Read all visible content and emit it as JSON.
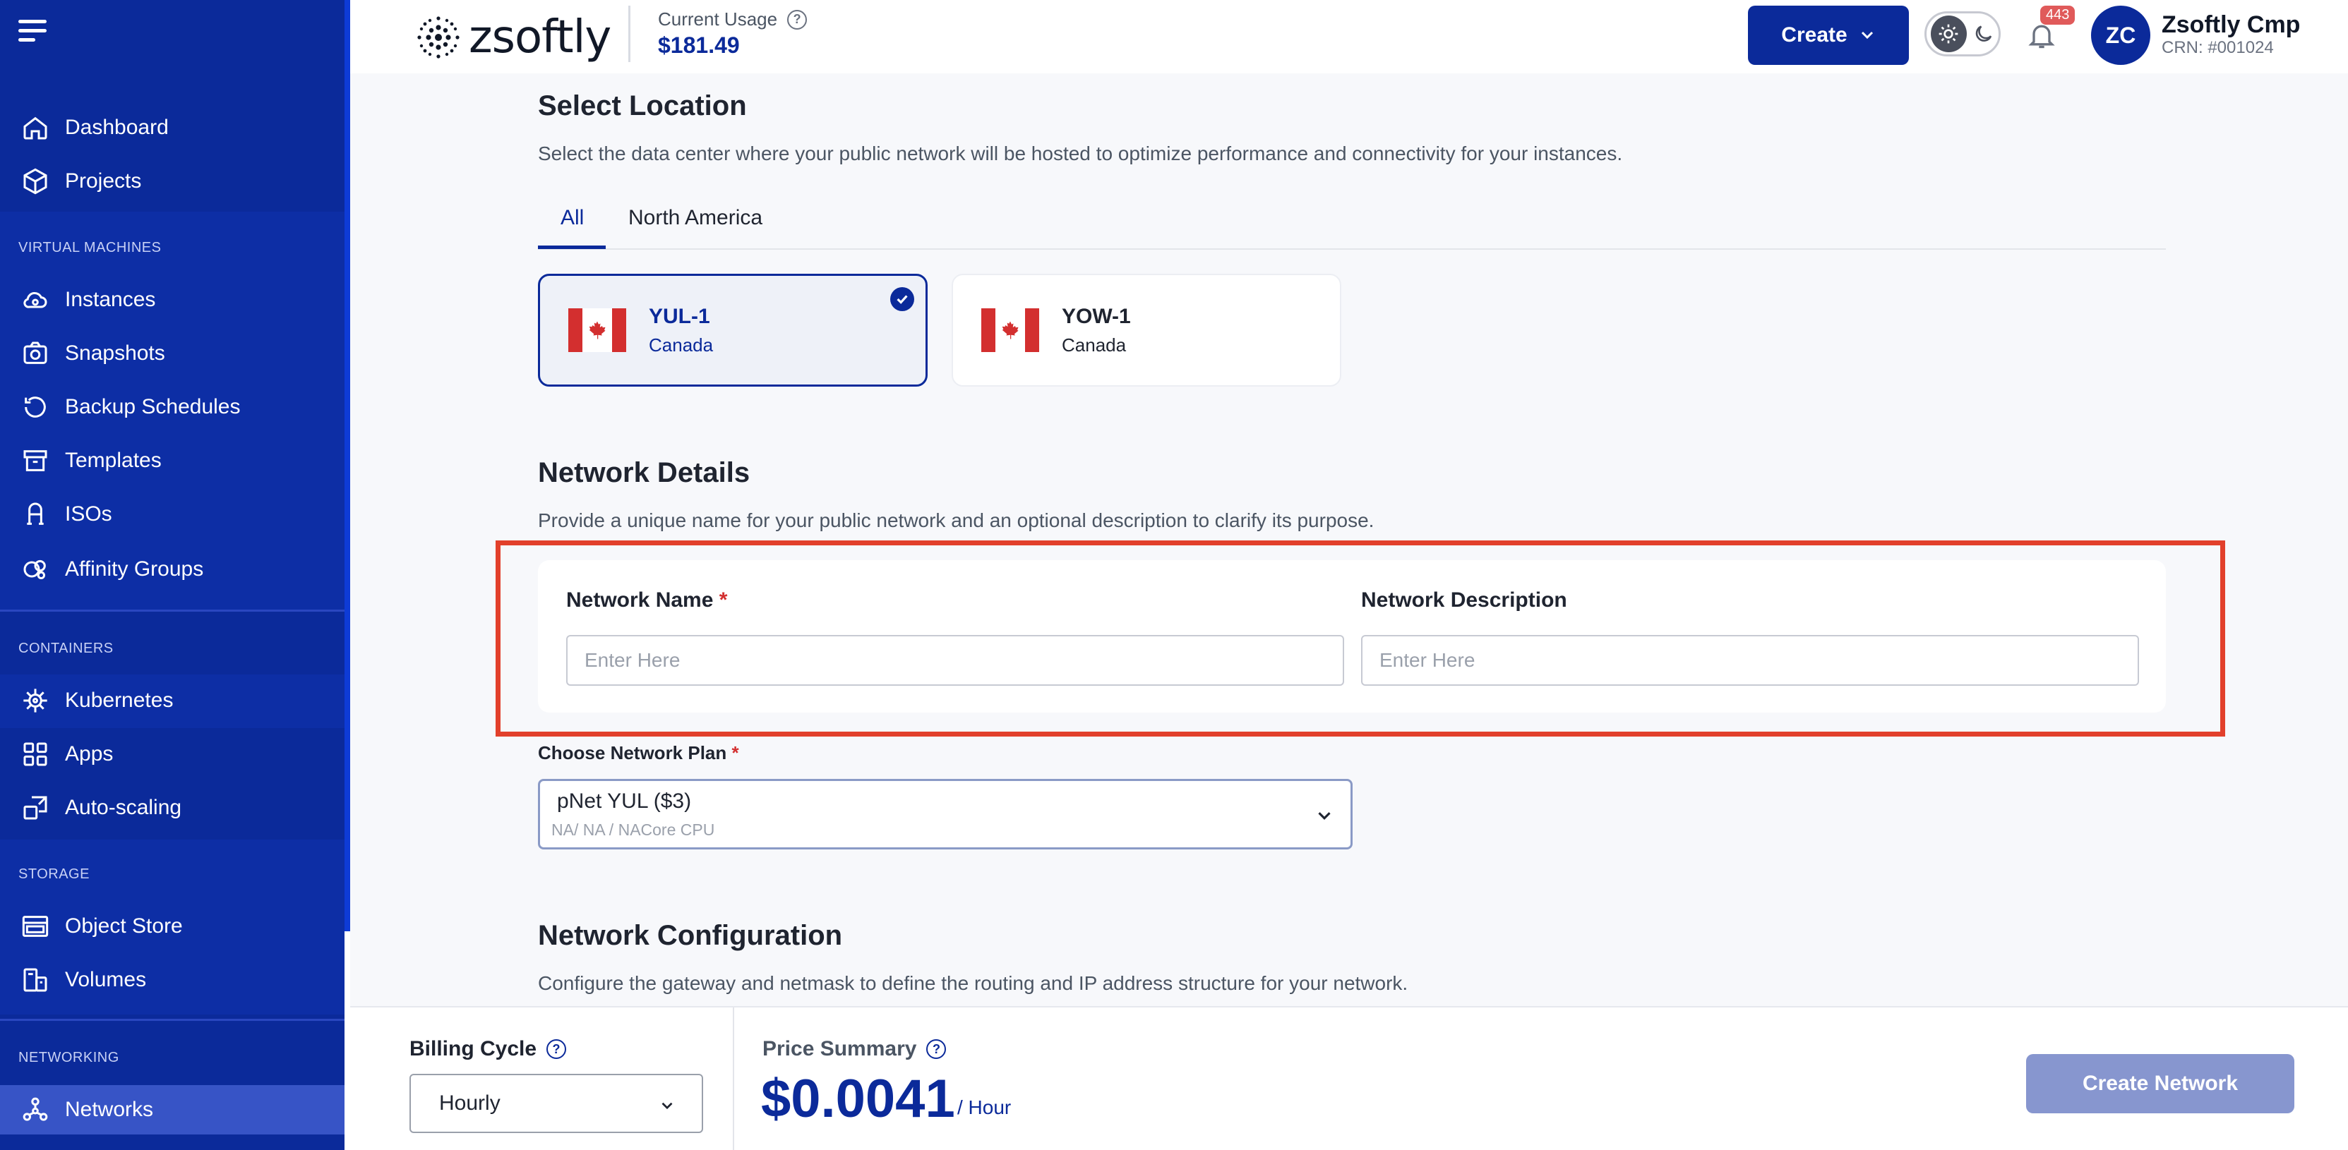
{
  "sidebar": {
    "nav": {
      "dashboard": "Dashboard",
      "projects": "Projects"
    },
    "sections": {
      "virtual_machines": {
        "label": "VIRTUAL MACHINES",
        "items": [
          "Instances",
          "Snapshots",
          "Backup Schedules",
          "Templates",
          "ISOs",
          "Affinity Groups"
        ]
      },
      "containers": {
        "label": "CONTAINERS",
        "items": [
          "Kubernetes",
          "Apps",
          "Auto-scaling"
        ]
      },
      "storage": {
        "label": "STORAGE",
        "items": [
          "Object Store",
          "Volumes"
        ]
      },
      "networking": {
        "label": "NETWORKING",
        "items": [
          "Networks"
        ],
        "active": "Networks"
      }
    }
  },
  "header": {
    "logo_text": "zsoftly",
    "usage_label": "Current Usage",
    "usage_value": "$181.49",
    "create_label": "Create",
    "notification_count": "443",
    "avatar_initials": "ZC",
    "user_name": "Zsoftly Cmp",
    "user_crn": "CRN: #001024"
  },
  "location": {
    "title": "Select Location",
    "description": "Select the data center where your public network will be hosted to optimize performance and connectivity for your instances.",
    "tabs": [
      "All",
      "North America"
    ],
    "active_tab": "All",
    "cards": [
      {
        "code": "YUL-1",
        "country": "Canada",
        "selected": true
      },
      {
        "code": "YOW-1",
        "country": "Canada",
        "selected": false
      }
    ]
  },
  "network_details": {
    "title": "Network Details",
    "description": "Provide a unique name for your public network and an optional description to clarify its purpose.",
    "name_label": "Network Name",
    "name_required_mark": "*",
    "name_placeholder": "Enter Here",
    "description_label": "Network Description",
    "description_placeholder": "Enter Here"
  },
  "plan": {
    "label": "Choose Network Plan",
    "required_mark": "*",
    "selected": "pNet YUL ($3)",
    "subtext": "NA/ NA / NACore CPU"
  },
  "network_configuration": {
    "title": "Network Configuration",
    "description": "Configure the gateway and netmask to define the routing and IP address structure for your network."
  },
  "footer": {
    "billing_label": "Billing Cycle",
    "billing_value": "Hourly",
    "price_label": "Price Summary",
    "price_value": "$0.0041",
    "price_unit": "/ Hour",
    "create_network_label": "Create Network"
  },
  "colors": {
    "brand": "#0b2a9a",
    "sidebar_active": "#3754c6",
    "highlight": "#e2402b",
    "disabled_button": "#8796cf"
  }
}
